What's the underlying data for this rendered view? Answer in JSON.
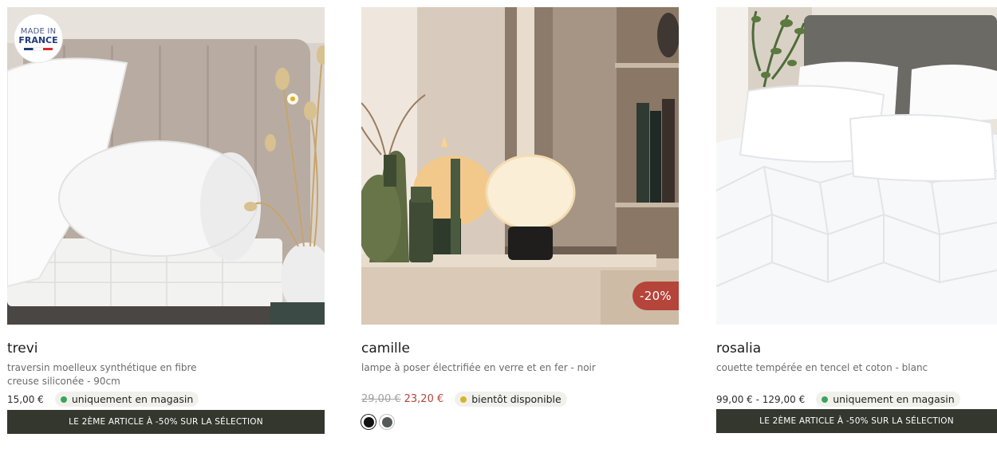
{
  "products": [
    {
      "name": "trevi",
      "description": "traversin moelleux synthétique en fibre creuse siliconée - 90cm",
      "price": "15,00 €",
      "availability": "uniquement en magasin",
      "badge": {
        "line1": "MADE IN",
        "line2": "FRANCE"
      },
      "promo": "LE 2ÈME ARTICLE À -50% SUR LA SÉLECTION",
      "image": "bolster-pillow-on-mattress"
    },
    {
      "name": "camille",
      "description": "lampe à poser électrifiée en verre et en fer - noir",
      "old_price": "29,00 €",
      "new_price": "23,20 €",
      "discount": "-20%",
      "availability": "bientôt disponible",
      "swatches": [
        "#111111",
        "#555a57"
      ],
      "image": "glass-table-lamp"
    },
    {
      "name": "rosalia",
      "description": "couette tempérée en tencel et coton - blanc",
      "price": "99,00 € - 129,00 €",
      "availability": "uniquement en magasin",
      "promo": "LE 2ÈME ARTICLE À -50% SUR LA SÉLECTION",
      "image": "white-duvet-on-bed"
    }
  ],
  "colors": {
    "in_store_dot": "#3aa55a",
    "soon_dot": "#d8b32a",
    "promo_bg": "#33372e",
    "discount_bg": "#b5443a",
    "flag_blue": "#1f3b78",
    "flag_red": "#d62b2b"
  }
}
